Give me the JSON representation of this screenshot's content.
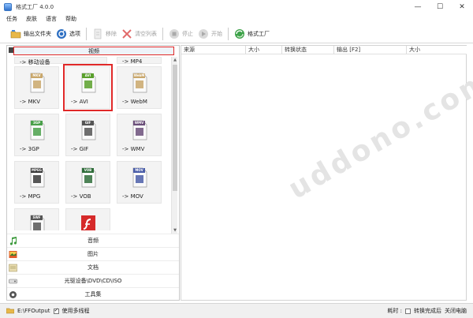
{
  "window": {
    "title": "格式工厂 4.0.0",
    "minimize": "—",
    "maximize": "☐",
    "close": "✕"
  },
  "menu": [
    "任务",
    "皮肤",
    "语言",
    "帮助"
  ],
  "toolbar": {
    "output_folder": "输出文件夹",
    "options": "选项",
    "remove": "移除",
    "clear_list": "清空列表",
    "stop": "停止",
    "start": "开始",
    "format_factory": "格式工厂"
  },
  "left": {
    "category_header": "视频",
    "top_row": [
      "-> 移动设备",
      "-> MP4"
    ],
    "tiles": [
      {
        "label": "-> MKV",
        "badge": "MKV",
        "icon": "mkv-file-icon",
        "color": "#c9a76b"
      },
      {
        "label": "-> AVI",
        "badge": "AVI",
        "icon": "avi-file-icon",
        "color": "#5aa02c"
      },
      {
        "label": "-> WebM",
        "badge": "WebM",
        "icon": "webm-file-icon",
        "color": "#c9a76b"
      },
      {
        "label": "-> 3GP",
        "badge": "3GP",
        "icon": "3gp-file-icon",
        "color": "#4aa04a"
      },
      {
        "label": "-> GIF",
        "badge": "GIF",
        "icon": "gif-file-icon",
        "color": "#555555"
      },
      {
        "label": "-> WMV",
        "badge": "WMV",
        "icon": "wmv-file-icon",
        "color": "#6b4f7a"
      },
      {
        "label": "-> MPG",
        "badge": "MPEG",
        "icon": "mpg-file-icon",
        "color": "#3a3a3a"
      },
      {
        "label": "-> VOB",
        "badge": "VOB",
        "icon": "vob-file-icon",
        "color": "#2f6d3a"
      },
      {
        "label": "-> MOV",
        "badge": "MOV",
        "icon": "mov-file-icon",
        "color": "#4b5ea8"
      },
      {
        "label": "",
        "badge": "SWF",
        "icon": "swf-file-icon",
        "color": "#555555"
      },
      {
        "label": "",
        "badge": "",
        "icon": "flash-file-icon",
        "color": "#cc2222"
      }
    ],
    "categories": [
      {
        "label": "音频",
        "icon": "music-note-icon"
      },
      {
        "label": "图片",
        "icon": "picture-icon"
      },
      {
        "label": "文档",
        "icon": "document-icon"
      },
      {
        "label": "光驱设备\\DVD\\CD\\ISO",
        "icon": "disc-drive-icon"
      },
      {
        "label": "工具集",
        "icon": "tools-icon"
      }
    ]
  },
  "table": {
    "columns": [
      "来源",
      "大小",
      "转换状态",
      "输出 [F2]",
      "大小"
    ]
  },
  "status": {
    "output_path": "E:\\FFOutput",
    "multithread": "使用多线程",
    "elapsed_label": "耗时 :",
    "after_convert": "转换完成后",
    "shutdown": "关闭电脑"
  },
  "watermark": "uddono.com"
}
